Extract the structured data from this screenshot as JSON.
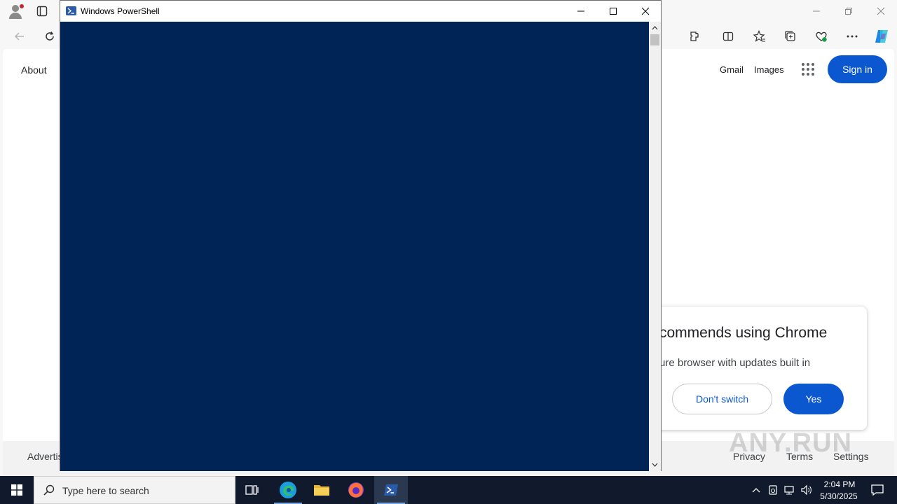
{
  "powershell": {
    "title": "Windows PowerShell"
  },
  "browser": {
    "page": {
      "about": "About",
      "gmail": "Gmail",
      "images": "Images",
      "sign_in": "Sign in"
    },
    "footer": {
      "advertising": "Advertis",
      "privacy": "Privacy",
      "terms": "Terms",
      "settings": "Settings"
    },
    "chrome_promo": {
      "title": "commends using Chrome",
      "text": "ure browser with updates built in",
      "dont_switch": "Don't switch",
      "yes": "Yes"
    },
    "watermark": "ANY.RUN"
  },
  "taskbar": {
    "search_placeholder": "Type here to search",
    "time": "2:04 PM",
    "date": "5/30/2025",
    "apps": [
      "task-view",
      "edge",
      "file-explorer",
      "firefox",
      "powershell"
    ]
  },
  "colors": {
    "console_bg": "#012456",
    "accent_blue": "#0b57d0",
    "taskbar_bg": "#101a2c"
  }
}
